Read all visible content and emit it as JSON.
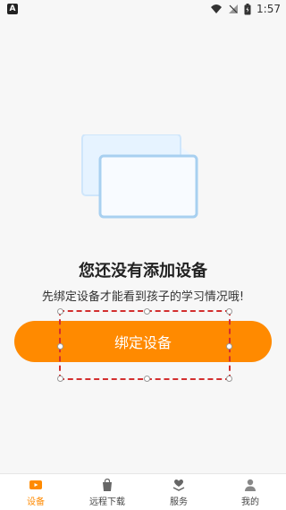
{
  "status_bar": {
    "left_icon": "A",
    "time": "1:57",
    "icons": [
      "wifi-icon",
      "signal-icon",
      "battery-icon"
    ]
  },
  "empty_state": {
    "title": "您还没有添加设备",
    "subtitle": "先绑定设备才能看到孩子的学习情况哦!"
  },
  "actions": {
    "bind_label": "绑定设备"
  },
  "bottom_nav": {
    "items": [
      {
        "label": "设备",
        "icon": "device-icon",
        "active": true
      },
      {
        "label": "远程下载",
        "icon": "bag-icon",
        "active": false
      },
      {
        "label": "服务",
        "icon": "heart-hand-icon",
        "active": false
      },
      {
        "label": "我的",
        "icon": "profile-icon",
        "active": false
      }
    ]
  },
  "colors": {
    "accent": "#ff8a00",
    "background": "#f7f7f7",
    "illustration_fill": "#e6f3ff",
    "illustration_border": "#a8d0f0"
  }
}
